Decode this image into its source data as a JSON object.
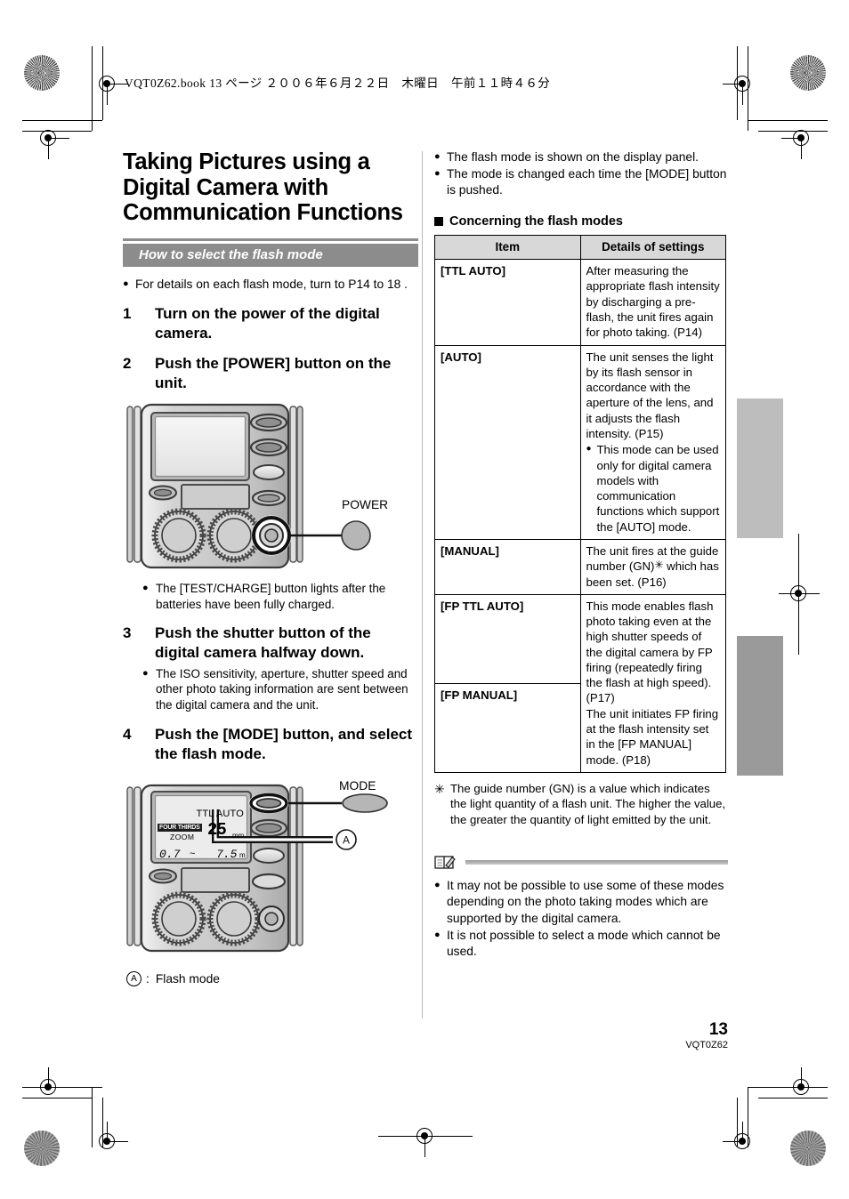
{
  "page": {
    "file_header": "VQT0Z62.book   13 ページ   ２００６年６月２２日　木曜日　午前１１時４６分",
    "number": "13",
    "manual_code": "VQT0Z62"
  },
  "left_column": {
    "title": "Taking Pictures using a Digital Camera with Communication Functions",
    "section_heading": "How to select the flash mode",
    "intro_bullet": "For details on each flash mode, turn to P14 to 18 .",
    "steps": [
      {
        "num": "1",
        "text": "Turn on the power of the digital camera."
      },
      {
        "num": "2",
        "text": "Push the [POWER] button on the unit."
      },
      {
        "num": "3",
        "text": "Push the shutter button of the digital camera halfway down."
      },
      {
        "num": "4",
        "text": "Push the [MODE] button, and select the flash mode."
      }
    ],
    "step2_note": "The [TEST/CHARGE] button lights after the batteries have been fully charged.",
    "step3_note": "The ISO sensitivity, aperture, shutter speed and other photo taking information are sent between the digital camera and the unit.",
    "figure1": {
      "callout_label": "POWER"
    },
    "figure2": {
      "callout_label": "MODE",
      "callout_letter": "A",
      "lcd": {
        "mode": "TTL AUTO",
        "badge": "FOUR THIRDS",
        "zoom_label": "ZOOM",
        "zoom_value": "25",
        "zoom_unit": "mm",
        "range_min": "0.7",
        "range_sep": "~",
        "range_max": "7.5",
        "range_unit": "m"
      },
      "caption_letter": "A",
      "caption_text": "Flash mode"
    }
  },
  "right_column": {
    "top_bullets": [
      "The flash mode is shown on the display panel.",
      "The mode is changed each time the [MODE] button is pushed."
    ],
    "table_heading": "Concerning the flash modes",
    "table": {
      "headers": [
        "Item",
        "Details of settings"
      ],
      "rows": [
        {
          "item": "[TTL AUTO]",
          "detail": "After measuring the appropriate flash intensity by discharging a pre-flash, the unit fires again for photo taking. (P14)",
          "sub_bullets": []
        },
        {
          "item": "[AUTO]",
          "detail": "The unit senses the light by its flash sensor in accordance with the aperture of the lens, and it adjusts the flash intensity. (P15)",
          "sub_bullets": [
            "This mode can be used only for digital camera models with communication functions which support the [AUTO] mode."
          ]
        },
        {
          "item": "[MANUAL]",
          "detail_pre": "The unit fires at the guide number (GN)",
          "detail_post": " which has been set. (P16)",
          "has_star": true,
          "sub_bullets": []
        },
        {
          "item": "[FP TTL AUTO]",
          "item2": "[FP MANUAL]",
          "detail": "This mode enables flash photo taking even at the high shutter speeds of the digital camera by FP firing (repeatedly firing the flash at high speed). (P17)",
          "detail2": "The unit initiates FP firing at the flash intensity set in the [FP MANUAL] mode. (P18)",
          "sub_bullets": []
        }
      ]
    },
    "footnote_marker": "✳",
    "footnote": "The guide number (GN) is a value which indicates the light quantity of a flash unit. The higher the value, the greater the quantity of light emitted by the unit.",
    "notes": [
      "It may not be possible to use some of these modes depending on the photo taking modes which are supported by the digital camera.",
      "It is not possible to select a mode which cannot be used."
    ]
  },
  "colors": {
    "section_bar": "#8c8c8c",
    "table_header": "#d8d8d8",
    "edge_tab_light": "#bdbdbd",
    "edge_tab_dark": "#9a9a9a"
  }
}
